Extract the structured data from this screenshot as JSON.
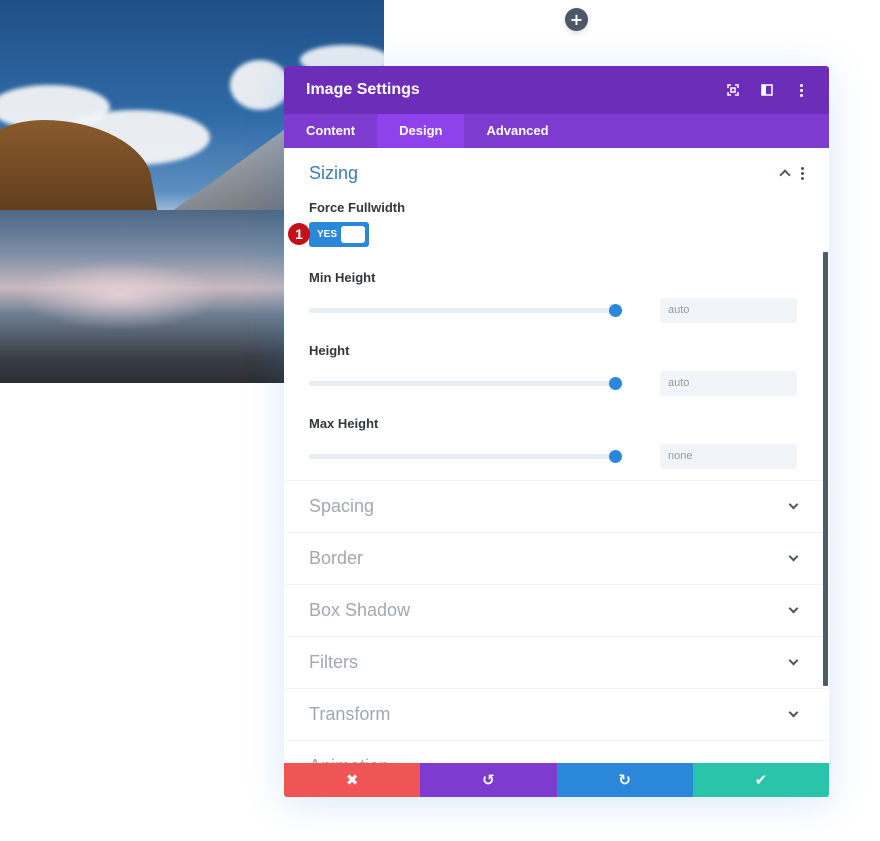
{
  "canvas": {
    "add_button_label": "+",
    "photo_alt": "Mountain lake landscape with clouds"
  },
  "modal": {
    "title": "Image Settings",
    "header_icons": [
      "fullscreen-icon",
      "split-view-icon",
      "more-options-icon"
    ],
    "tabs": [
      {
        "label": "Content",
        "active": false
      },
      {
        "label": "Design",
        "active": true
      },
      {
        "label": "Advanced",
        "active": false
      }
    ],
    "sizing": {
      "title": "Sizing",
      "force_fullwidth": {
        "label": "Force Fullwidth",
        "value": "YES",
        "enabled": true,
        "badge": "1"
      },
      "min_height": {
        "label": "Min Height",
        "value": "auto",
        "slider_percent": 100
      },
      "height": {
        "label": "Height",
        "value": "auto",
        "slider_percent": 100
      },
      "max_height": {
        "label": "Max Height",
        "value": "none",
        "slider_percent": 100
      }
    },
    "collapsed_sections": [
      {
        "title": "Spacing"
      },
      {
        "title": "Border"
      },
      {
        "title": "Box Shadow"
      },
      {
        "title": "Filters"
      },
      {
        "title": "Transform"
      },
      {
        "title": "Animation"
      }
    ],
    "footer": {
      "cancel_icon": "✖",
      "undo_icon": "↺",
      "redo_icon": "↻",
      "save_icon": "✔"
    },
    "colors": {
      "header": "#6c2eb9",
      "tabs": "#7e3bd0",
      "active_tab": "#8f42ec",
      "accent": "#2b87da",
      "cancel": "#ef5555",
      "undo": "#7d3bcf",
      "redo": "#2b87da",
      "save": "#29c4a9",
      "badge": "#c3101a"
    }
  }
}
